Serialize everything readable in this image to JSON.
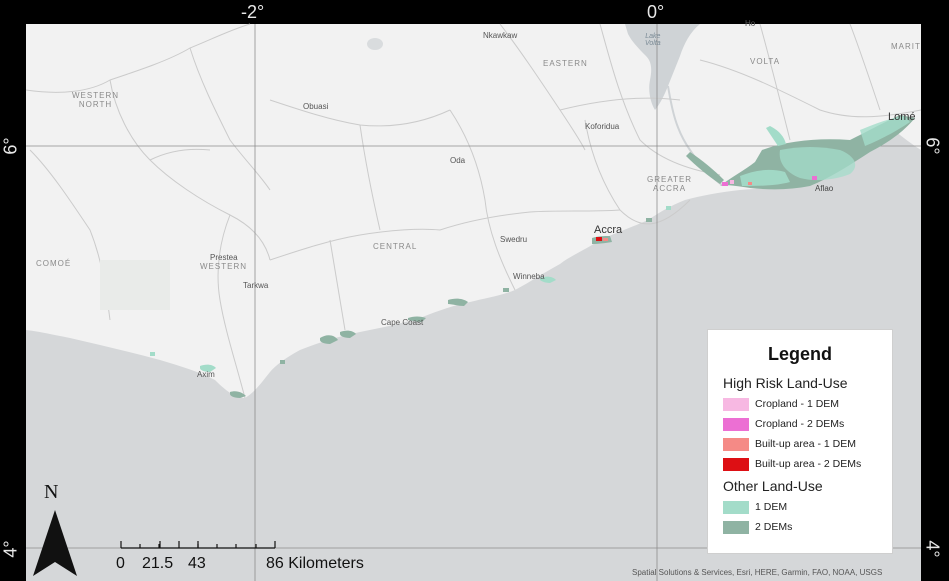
{
  "graticule": {
    "top": [
      "-2°",
      "0°"
    ],
    "left": [
      "6°",
      "4°"
    ],
    "right": [
      "6°",
      "4°"
    ]
  },
  "places": {
    "nkawkaw": "Nkawkaw",
    "ho": "Ho",
    "obuasi": "Obuasi",
    "koforidua": "Koforidua",
    "oda": "Oda",
    "lome": "Lomé",
    "aflao": "Aflao",
    "accra": "Accra",
    "swedru": "Swedru",
    "winneba": "Winneba",
    "prestea": "Prestea",
    "tarkwa": "Tarkwa",
    "cape_coast": "Cape Coast",
    "axim": "Axim",
    "lake_volta": "Lake\nVolta"
  },
  "regions": {
    "western_north": "WESTERN\nNORTH",
    "eastern": "EASTERN",
    "volta": "VOLTA",
    "maritime": "MARIT",
    "greater_accra": "GREATER\nACCRA",
    "central": "CENTRAL",
    "western": "WESTERN",
    "comoe": "COMOÉ"
  },
  "legend": {
    "title": "Legend",
    "group1": "High Risk Land-Use",
    "items1": [
      {
        "label": "Cropland - 1 DEM",
        "color": "#f7b8e2"
      },
      {
        "label": "Cropland - 2 DEMs",
        "color": "#ec6fd3"
      },
      {
        "label": "Built-up area - 1 DEM",
        "color": "#f58a86"
      },
      {
        "label": "Built-up area - 2 DEMs",
        "color": "#dd0f14"
      }
    ],
    "group2": "Other Land-Use",
    "items2": [
      {
        "label": "1 DEM",
        "color": "#a3dcc9"
      },
      {
        "label": "2 DEMs",
        "color": "#8fb3a3"
      }
    ]
  },
  "north_arrow": {
    "letter": "N"
  },
  "scale_bar": {
    "ticks": [
      "0",
      "21.5",
      "43",
      "86 Kilometers"
    ]
  },
  "attribution": "Spatial Solutions & Services, Esri, HERE, Garmin, FAO, NOAA, USGS",
  "colors": {
    "land": "#f2f2f2",
    "sea": "#d5d7d9",
    "frame": "#000000",
    "boundary": "#c9c9c9",
    "graticule": "#8c8c8c"
  }
}
